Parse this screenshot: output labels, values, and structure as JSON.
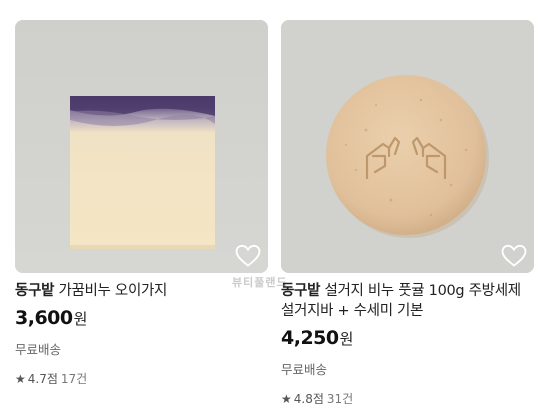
{
  "products": [
    {
      "brand": "동구밭",
      "name": "가꿈비누 오이가지",
      "price": "3,600",
      "price_unit": "원",
      "shipping": "무료배송",
      "rating": "4.7점",
      "review_count": "17건"
    },
    {
      "brand": "동구밭",
      "name": "설거지 비누 풋귤 100g 주방세제 설거지바 + 수세미 기본",
      "price": "4,250",
      "price_unit": "원",
      "shipping": "무료배송",
      "rating": "4.8점",
      "review_count": "31건"
    }
  ],
  "icons": {
    "wishlist": "heart-outline-icon",
    "rating": "star-icon"
  },
  "colors": {
    "image_background": "#d1d1cd",
    "soap_cream": "#f2e4c2",
    "soap_purple": "#4b3b6b",
    "round_soap": "#e2c39e"
  },
  "watermark": "뷰티풀랜드"
}
